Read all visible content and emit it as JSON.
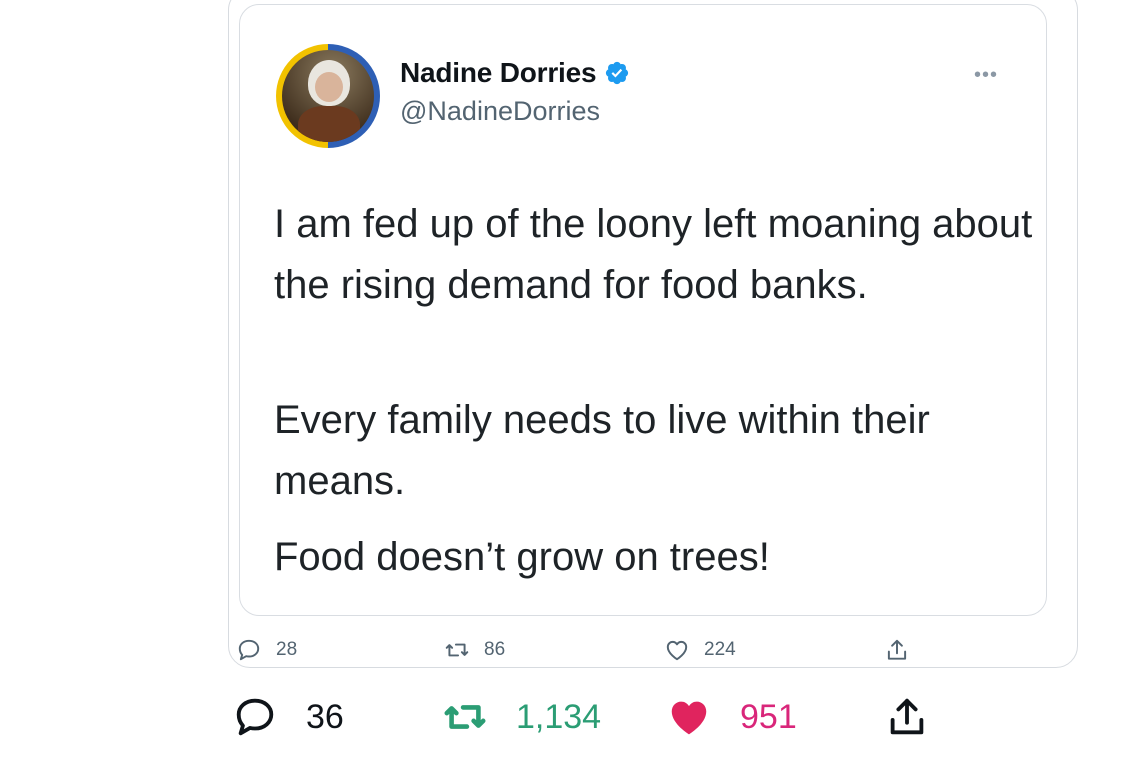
{
  "quoted_tweet": {
    "author": {
      "display_name": "Nadine Dorries",
      "handle": "@NadineDorries",
      "verified": true,
      "avatar_ring_colors": [
        "#2e5fb5",
        "#f2c200"
      ]
    },
    "more_icon": "more-horizontal-icon",
    "paragraphs": [
      "I am fed up of the loony left moaning about the rising demand for food banks.",
      "Every family needs to live within their means.",
      "Food doesn’t grow on trees!"
    ]
  },
  "quoted_actions": {
    "reply_count": "28",
    "retweet_count": "86",
    "like_count": "224"
  },
  "tweet_actions": {
    "reply_count": "36",
    "retweet_count": "1,134",
    "like_count": "951"
  },
  "colors": {
    "verified": "#1d9bf0",
    "retweet_active": "#2b9d74",
    "like_active": "#e0245e",
    "muted_text": "#536471",
    "border": "#d7dbe0"
  },
  "icons": [
    "reply-icon",
    "retweet-icon",
    "like-icon",
    "share-icon",
    "verified-badge-icon"
  ]
}
